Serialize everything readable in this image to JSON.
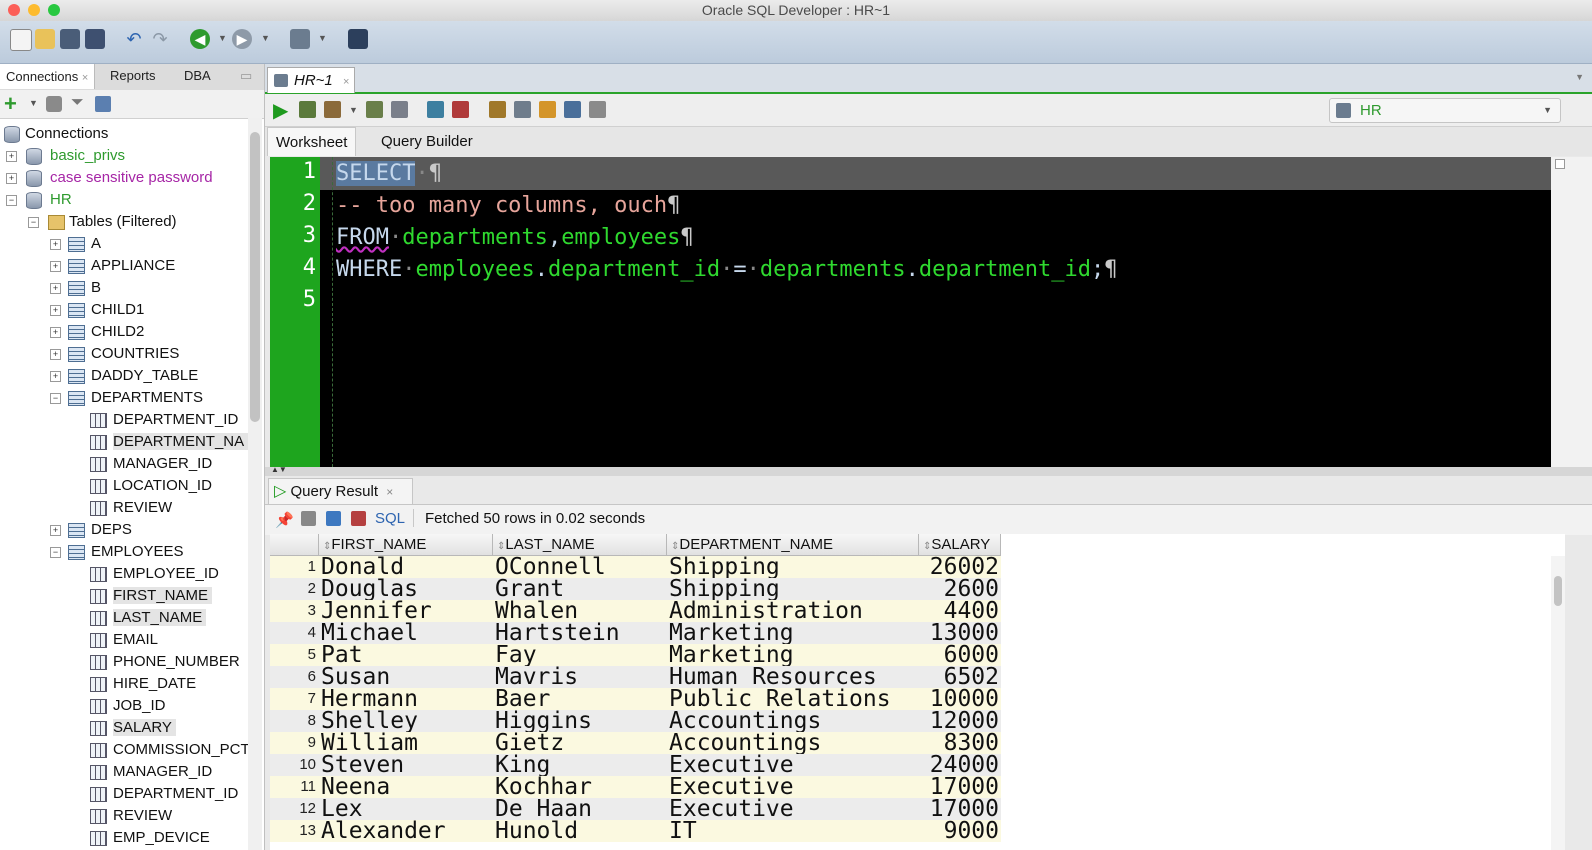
{
  "window": {
    "title": "Oracle SQL Developer : HR~1"
  },
  "left_tabs": [
    "Connections",
    "Reports",
    "DBA"
  ],
  "tree": {
    "root": "Connections",
    "connections": [
      {
        "label": "basic_privs",
        "color": "#2e9a2e"
      },
      {
        "label": "case sensitive password",
        "color": "#a626a6"
      },
      {
        "label": "HR",
        "color": "#2e9a2e"
      }
    ],
    "tables_node": "Tables (Filtered)",
    "tables": [
      "A",
      "APPLIANCE",
      "B",
      "CHILD1",
      "CHILD2",
      "COUNTRIES",
      "DADDY_TABLE",
      "DEPARTMENTS"
    ],
    "departments_columns": [
      "DEPARTMENT_ID",
      "DEPARTMENT_NA",
      "MANAGER_ID",
      "LOCATION_ID",
      "REVIEW"
    ],
    "more_tables": [
      "DEPS",
      "EMPLOYEES"
    ],
    "employees_columns": [
      "EMPLOYEE_ID",
      "FIRST_NAME",
      "LAST_NAME",
      "EMAIL",
      "PHONE_NUMBER",
      "HIRE_DATE",
      "JOB_ID",
      "SALARY",
      "COMMISSION_PCT",
      "MANAGER_ID",
      "DEPARTMENT_ID",
      "REVIEW",
      "EMP_DEVICE"
    ]
  },
  "editor": {
    "tab_label": "HR~1",
    "connection": "HR",
    "subtabs": [
      "Worksheet",
      "Query Builder"
    ],
    "line_numbers": [
      "1",
      "2",
      "3",
      "4",
      "5"
    ],
    "code": {
      "l1_kw": "SELECT",
      "l2_comment": "-- too many columns, ouch",
      "l3_kw": "FROM",
      "l3_t1": "departments",
      "l3_t2": "employees",
      "l4_kw": "WHERE",
      "l4_a": "employees",
      "l4_a_col": "department_id",
      "l4_op": "=",
      "l4_b": "departments",
      "l4_b_col": "department_id",
      "pilcrow": "¶",
      "space_dot": "·"
    }
  },
  "results": {
    "tab_label": "Query Result",
    "sql_label": "SQL",
    "status": "Fetched 50 rows in 0.02 seconds",
    "columns": [
      "FIRST_NAME",
      "LAST_NAME",
      "DEPARTMENT_NAME",
      "SALARY"
    ],
    "rows": [
      [
        "1",
        "Donald",
        "OConnell",
        "Shipping",
        "26002"
      ],
      [
        "2",
        "Douglas",
        "Grant",
        "Shipping",
        "2600"
      ],
      [
        "3",
        "Jennifer",
        "Whalen",
        "Administration",
        "4400"
      ],
      [
        "4",
        "Michael",
        "Hartstein",
        "Marketing",
        "13000"
      ],
      [
        "5",
        "Pat",
        "Fay",
        "Marketing",
        "6000"
      ],
      [
        "6",
        "Susan",
        "Mavris",
        "Human Resources",
        "6502"
      ],
      [
        "7",
        "Hermann",
        "Baer",
        "Public Relations",
        "10000"
      ],
      [
        "8",
        "Shelley",
        "Higgins",
        "Accountings",
        "12000"
      ],
      [
        "9",
        "William",
        "Gietz",
        "Accountings",
        "8300"
      ],
      [
        "10",
        "Steven",
        "King",
        "Executive",
        "24000"
      ],
      [
        "11",
        "Neena",
        "Kochhar",
        "Executive",
        "17000"
      ],
      [
        "12",
        "Lex",
        "De Haan",
        "Executive",
        "17000"
      ],
      [
        "13",
        "Alexander",
        "Hunold",
        "IT",
        "9000"
      ]
    ]
  }
}
